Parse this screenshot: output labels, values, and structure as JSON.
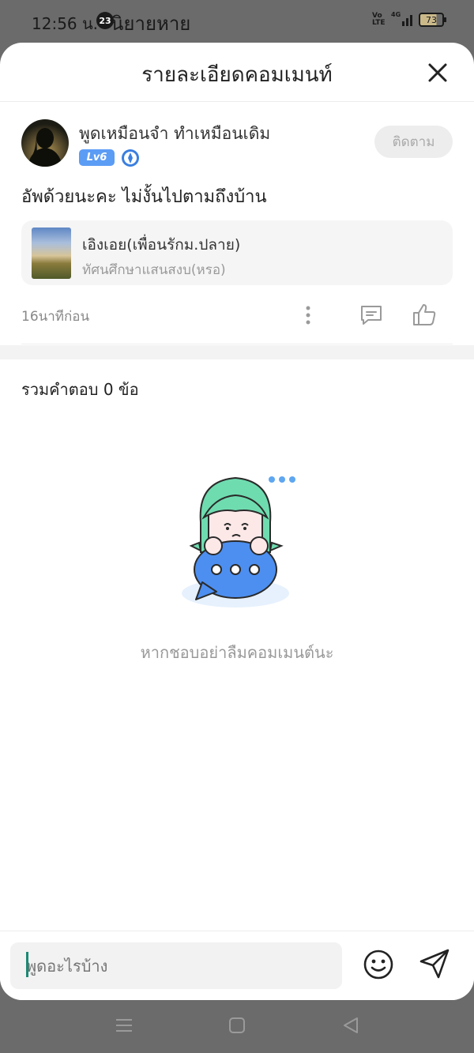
{
  "status_bar": {
    "time": "12:56 น.",
    "notification_count": "23",
    "behind_text": "นิยายหาย",
    "volte": "Vo LTE",
    "network": "4G",
    "battery": "73"
  },
  "sheet": {
    "title": "รายละเอียดคอมเมนท์"
  },
  "comment": {
    "username": "พูดเหมือนจำ ทำเหมือนเดิม",
    "level": "Lv6",
    "follow_label": "ติดตาม",
    "text": "อัพด้วยนะคะ ไม่งั้นไปตามถึงบ้าน",
    "book": {
      "title": "เอิงเอย(เพื่อนรักม.ปลาย)",
      "subtitle": "ทัศนศึกษาแสนสงบ(หรอ)"
    },
    "timestamp": "16นาทีก่อน"
  },
  "replies": {
    "count_label": "รวมคำตอบ 0 ข้อ",
    "empty_text": "หากชอบอย่าลืมคอมเมนต์นะ"
  },
  "input": {
    "placeholder": "พูดอะไรบ้าง"
  },
  "colors": {
    "level_badge": "#5b9cf5",
    "accent_teal": "#1a8a74",
    "mascot_hair": "#6fdcb0",
    "mascot_bubble": "#4d8ff0"
  },
  "icons": {
    "close": "close-icon",
    "more": "more-vertical-icon",
    "reply": "comment-icon",
    "like": "thumbs-up-icon",
    "emoji": "smiley-icon",
    "send": "send-icon"
  }
}
